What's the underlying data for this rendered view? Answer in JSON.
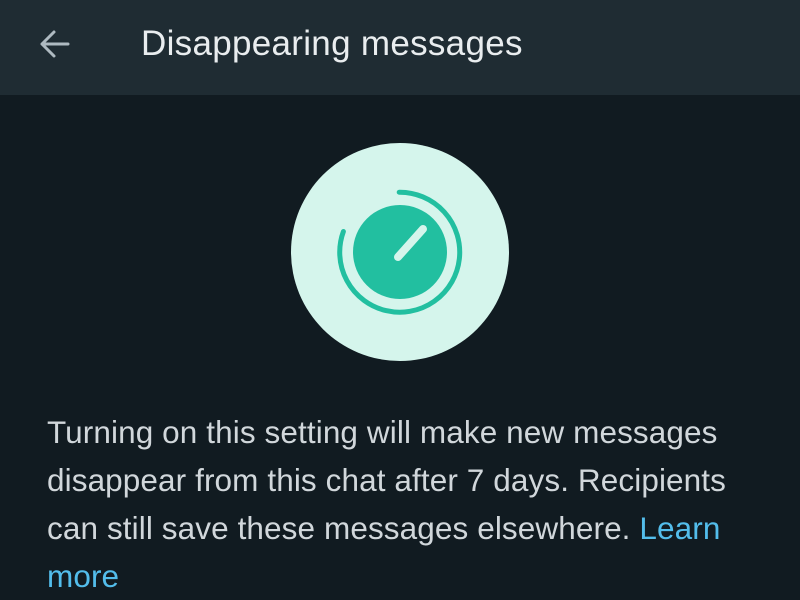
{
  "header": {
    "back_icon": "arrow-left-icon",
    "title": "Disappearing messages"
  },
  "hero": {
    "icon": "timer-icon",
    "circle_color": "#d5f5ec",
    "accent_color": "#22bfa0"
  },
  "body": {
    "description": "Turning on this setting will make new messages disappear from this chat after 7 days. Recipients can still save these messages elsewhere.",
    "learn_more_label": "Learn more",
    "link_color": "#53bdeb"
  },
  "colors": {
    "background": "#111b21",
    "app_bar": "#1f2c33",
    "title_text": "#e9edef",
    "body_text": "#d1d7db"
  }
}
